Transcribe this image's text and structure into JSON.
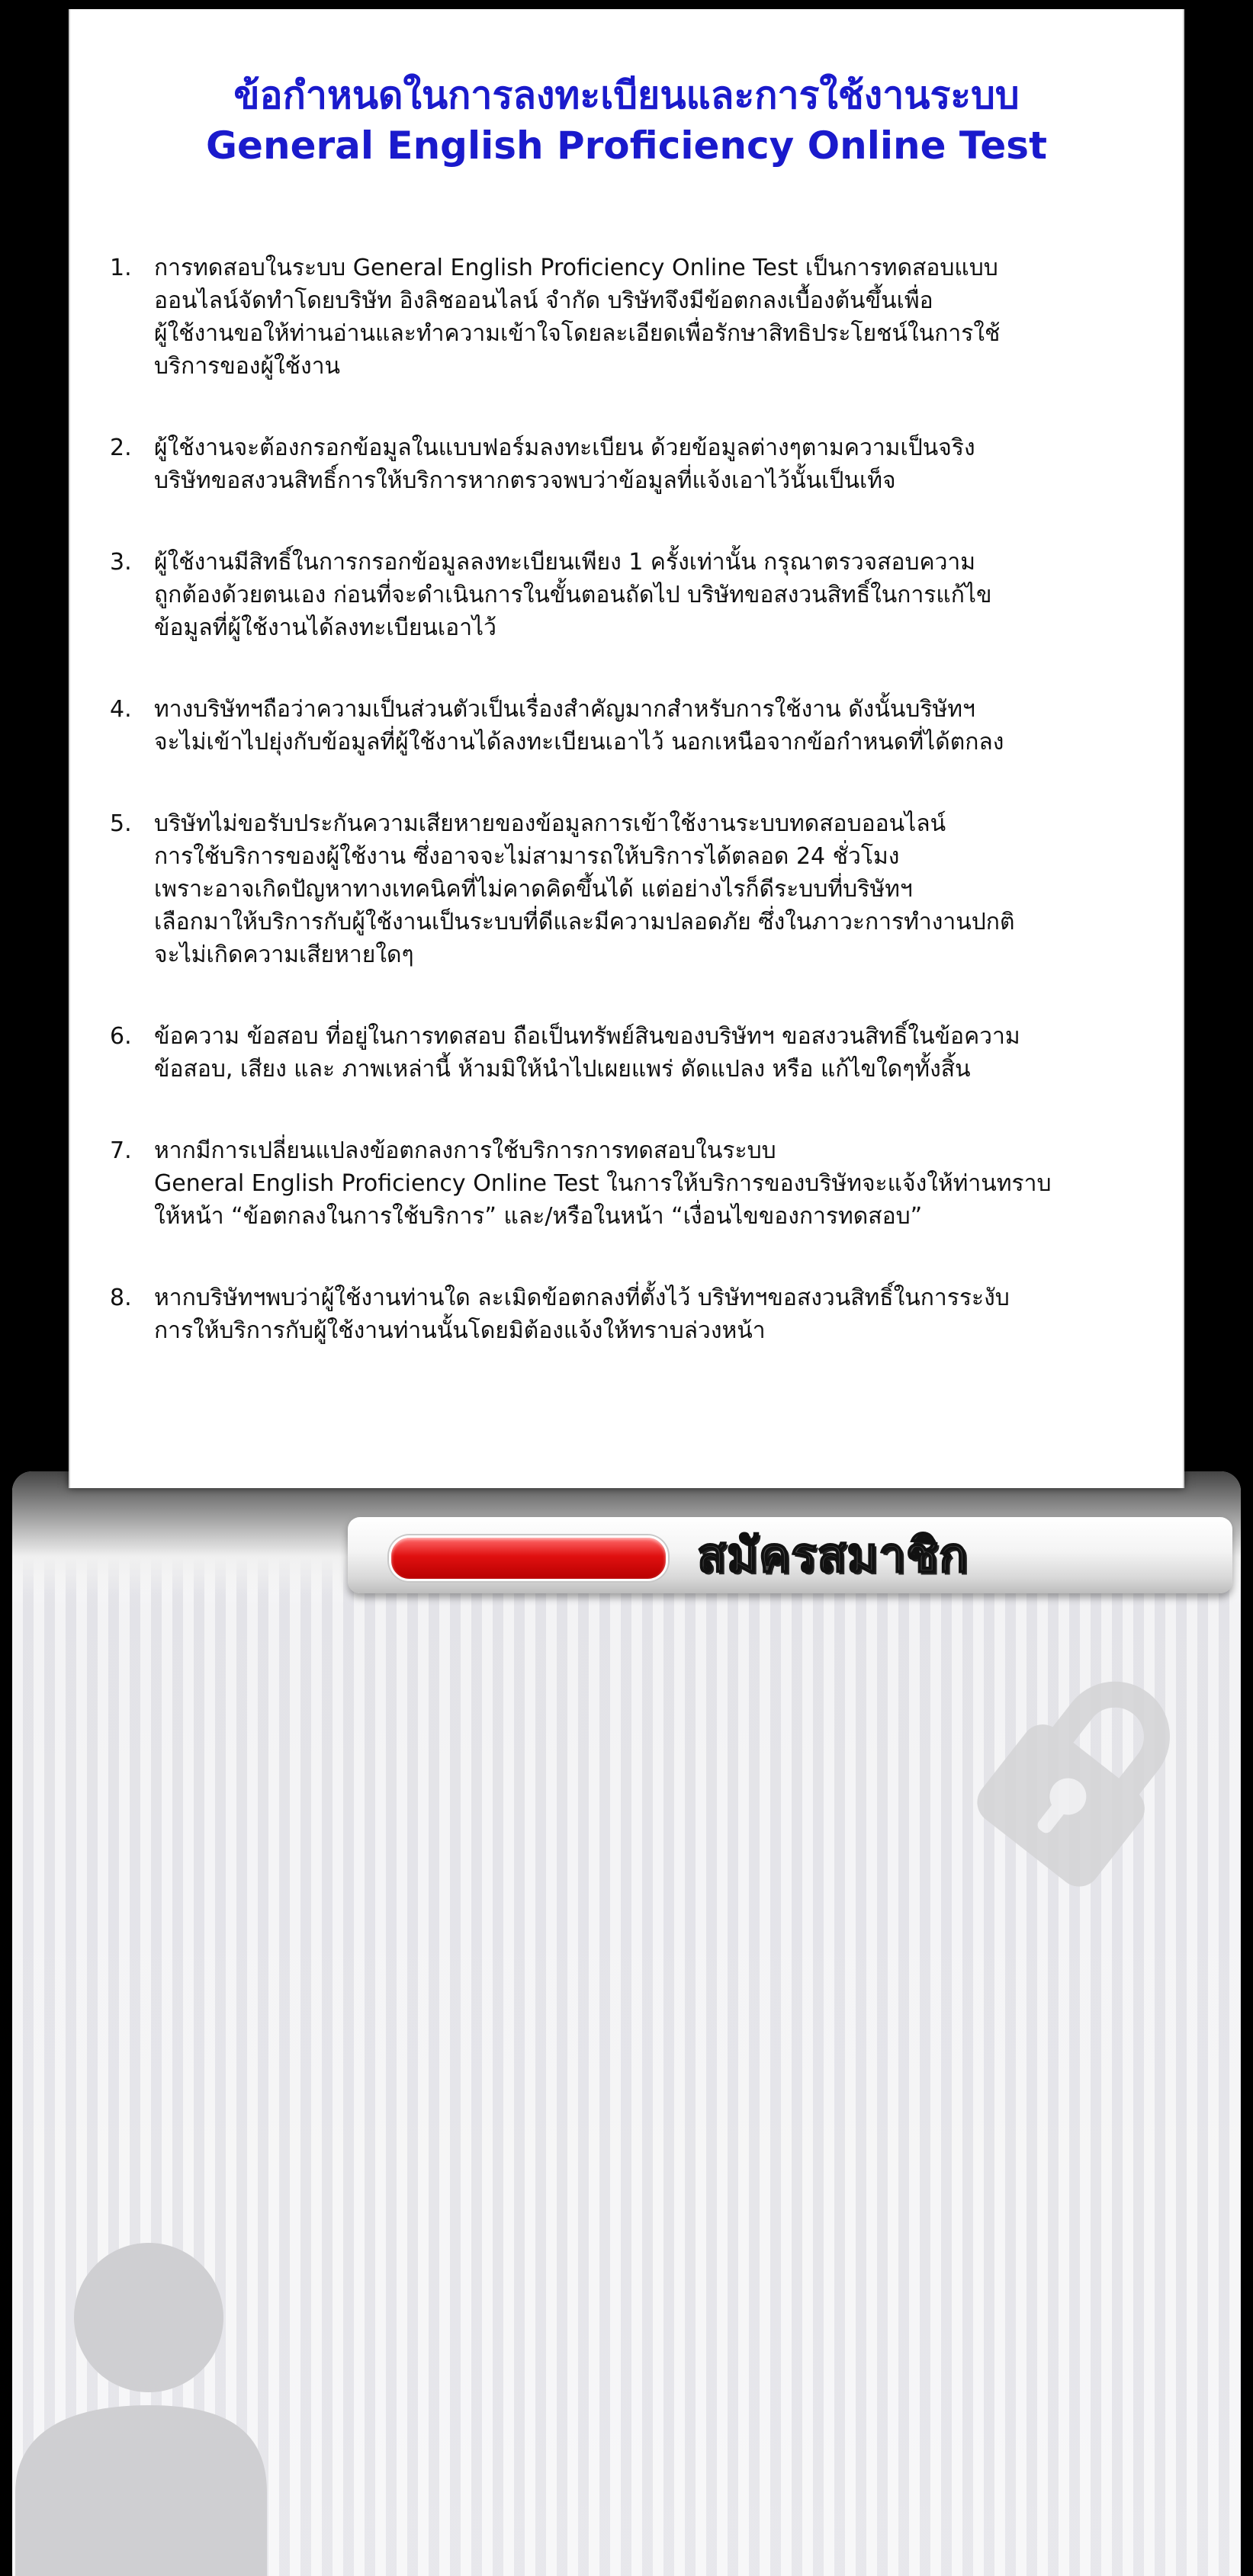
{
  "document": {
    "title_line1": "ข้อกำหนดในการลงทะเบียนและการใช้งานระบบ",
    "title_line2": "General English Proficiency Online Test",
    "terms": [
      {
        "number": "1.",
        "lines": [
          "การทดสอบในระบบ General English Proficiency Online Test เป็นการทดสอบแบบ",
          "ออนไลน์จัดทำโดยบริษัท อิงลิชออนไลน์ จำกัด บริษัทจึงมีข้อตกลงเบื้องต้นขึ้นเพื่อ",
          "ผู้ใช้งานขอให้ท่านอ่านและทำความเข้าใจโดยละเอียดเพื่อรักษาสิทธิประโยชน์ในการใช้",
          "บริการของผู้ใช้งาน"
        ]
      },
      {
        "number": "2.",
        "lines": [
          "ผู้ใช้งานจะต้องกรอกข้อมูลในแบบฟอร์มลงทะเบียน ด้วยข้อมูลต่างๆตามความเป็นจริง",
          "บริษัทขอสงวนสิทธิ์การให้บริการหากตรวจพบว่าข้อมูลที่แจ้งเอาไว้นั้นเป็นเท็จ"
        ]
      },
      {
        "number": "3.",
        "lines": [
          "ผู้ใช้งานมีสิทธิ์ในการกรอกข้อมูลลงทะเบียนเพียง 1 ครั้งเท่านั้น กรุณาตรวจสอบความ",
          "ถูกต้องด้วยตนเอง ก่อนที่จะดำเนินการในขั้นตอนถัดไป บริษัทขอสงวนสิทธิ์ในการแก้ไข",
          "ข้อมูลที่ผู้ใช้งานได้ลงทะเบียนเอาไว้"
        ]
      },
      {
        "number": "4.",
        "lines": [
          "ทางบริษัทฯถือว่าความเป็นส่วนตัวเป็นเรื่องสำคัญมากสำหรับการใช้งาน ดังนั้นบริษัทฯ",
          "จะไม่เข้าไปยุ่งกับข้อมูลที่ผู้ใช้งานได้ลงทะเบียนเอาไว้ นอกเหนือจากข้อกำหนดที่ได้ตกลง"
        ]
      },
      {
        "number": "5.",
        "lines": [
          "บริษัทไม่ขอรับประกันความเสียหายของข้อมูลการเข้าใช้งานระบบทดสอบออนไลน์",
          "การใช้บริการของผู้ใช้งาน ซึ่งอาจจะไม่สามารถให้บริการได้ตลอด 24 ชั่วโมง",
          "เพราะอาจเกิดปัญหาทางเทคนิคที่ไม่คาดคิดขึ้นได้ แต่อย่างไรก็ดีระบบที่บริษัทฯ",
          "เลือกมาให้บริการกับผู้ใช้งานเป็นระบบที่ดีและมีความปลอดภัย ซึ่งในภาวะการทำงานปกติ",
          "จะไม่เกิดความเสียหายใดๆ"
        ]
      },
      {
        "number": "6.",
        "lines": [
          "ข้อความ ข้อสอบ ที่อยู่ในการทดสอบ ถือเป็นทรัพย์สินของบริษัทฯ ขอสงวนสิทธิ์ในข้อความ",
          "ข้อสอบ, เสียง และ ภาพเหล่านี้ ห้ามมิให้นำไปเผยแพร่ ดัดแปลง หรือ แก้ไขใดๆทั้งสิ้น"
        ]
      },
      {
        "number": "7.",
        "lines": [
          "หากมีการเปลี่ยนแปลงข้อตกลงการใช้บริการการทดสอบในระบบ",
          "General English Proficiency Online Test ในการให้บริการของบริษัทจะแจ้งให้ท่านทราบ",
          "ให้หน้า “ข้อตกลงในการใช้บริการ” และ/หรือในหน้า “เงื่อนไขของการทดสอบ”"
        ]
      },
      {
        "number": "8.",
        "lines": [
          "หากบริษัทฯพบว่าผู้ใช้งานท่านใด ละเมิดข้อตกลงที่ตั้งไว้ บริษัทฯขอสงวนสิทธิ์ในการระงับ",
          "การให้บริการกับผู้ใช้งานท่านนั้นโดยมิต้องแจ้งให้ทราบล่วงหน้า"
        ]
      }
    ]
  },
  "register": {
    "label": "สมัครสมาชิก"
  },
  "icons": {
    "lock": "lock-icon",
    "person": "person-icon"
  },
  "colors": {
    "title": "#1a1acc",
    "register_pill": "#e01010",
    "background": "#000000"
  }
}
